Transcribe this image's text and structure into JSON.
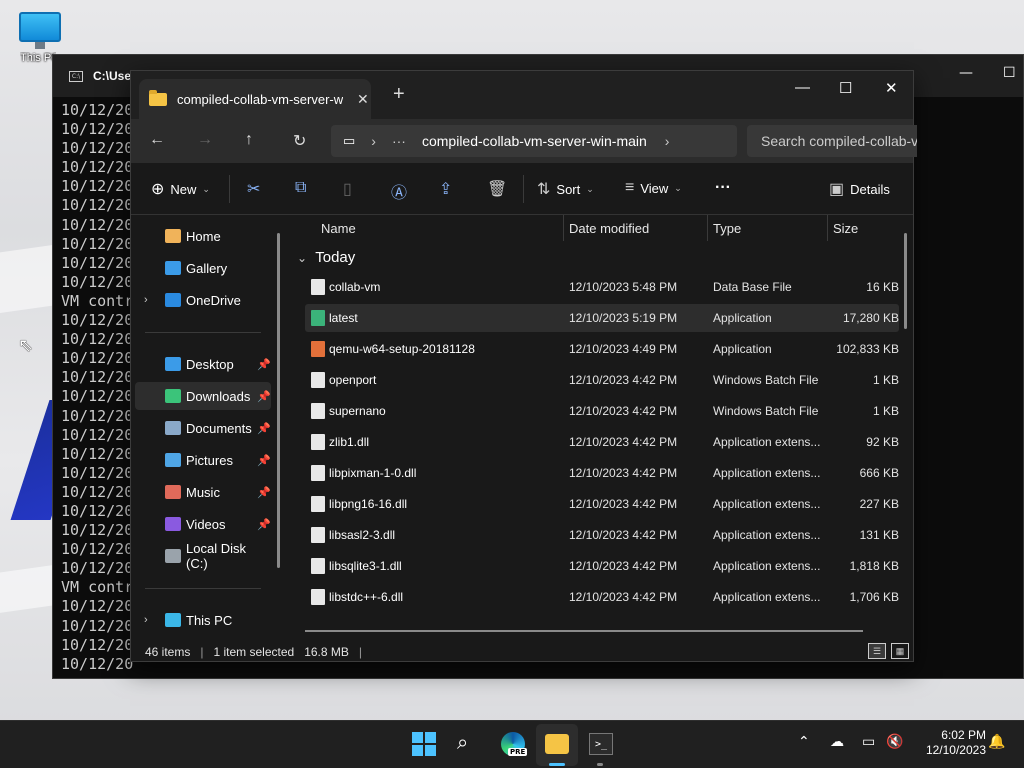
{
  "desktop": {
    "icon_label": "This PC",
    "cursor": "⇖"
  },
  "terminal": {
    "title": "C:\\Use",
    "tab_icon": "C:\\",
    "lines": [
      "10/12/20",
      "10/12/20",
      "10/12/20",
      "10/12/20",
      "10/12/20",
      "10/12/20",
      "10/12/20",
      "10/12/20",
      "10/12/20",
      "10/12/20",
      "VM contr",
      "10/12/20",
      "10/12/20",
      "10/12/20",
      "10/12/20",
      "10/12/20",
      "10/12/20",
      "10/12/20",
      "10/12/20",
      "10/12/20",
      "10/12/20",
      "10/12/20",
      "10/12/20",
      "10/12/20",
      "10/12/20",
      "VM contr",
      "10/12/20",
      "10/12/20",
      "10/12/20",
      "10/12/20"
    ]
  },
  "explorer": {
    "tab_title": "compiled-collab-vm-server-wi",
    "breadcrumb": "compiled-collab-vm-server-win-main",
    "search_placeholder": "Search compiled-collab-v",
    "toolbar": {
      "new": "New",
      "sort": "Sort",
      "view": "View",
      "details": "Details"
    },
    "sidebar": [
      {
        "label": "Home",
        "color": "#f0b35a"
      },
      {
        "label": "Gallery",
        "color": "#3b9be8"
      },
      {
        "label": "OneDrive",
        "color": "#2a8ae0"
      },
      {
        "label": "Desktop",
        "color": "#3b9be8"
      },
      {
        "label": "Downloads",
        "color": "#3bc47a"
      },
      {
        "label": "Documents",
        "color": "#8aa9c9"
      },
      {
        "label": "Pictures",
        "color": "#4fa6e6"
      },
      {
        "label": "Music",
        "color": "#e06a5a"
      },
      {
        "label": "Videos",
        "color": "#8a5ae0"
      },
      {
        "label": "Local Disk (C:)",
        "color": "#9aa3ab"
      },
      {
        "label": "This PC",
        "color": "#3bb7e8"
      }
    ],
    "columns": {
      "name": "Name",
      "date": "Date modified",
      "type": "Type",
      "size": "Size"
    },
    "group": "Today",
    "files": [
      {
        "name": "collab-vm",
        "date": "12/10/2023 5:48 PM",
        "type": "Data Base File",
        "size": "16 KB"
      },
      {
        "name": "latest",
        "date": "12/10/2023 5:19 PM",
        "type": "Application",
        "size": "17,280 KB"
      },
      {
        "name": "qemu-w64-setup-20181128",
        "date": "12/10/2023 4:49 PM",
        "type": "Application",
        "size": "102,833 KB"
      },
      {
        "name": "openport",
        "date": "12/10/2023 4:42 PM",
        "type": "Windows Batch File",
        "size": "1 KB"
      },
      {
        "name": "supernano",
        "date": "12/10/2023 4:42 PM",
        "type": "Windows Batch File",
        "size": "1 KB"
      },
      {
        "name": "zlib1.dll",
        "date": "12/10/2023 4:42 PM",
        "type": "Application extens...",
        "size": "92 KB"
      },
      {
        "name": "libpixman-1-0.dll",
        "date": "12/10/2023 4:42 PM",
        "type": "Application extens...",
        "size": "666 KB"
      },
      {
        "name": "libpng16-16.dll",
        "date": "12/10/2023 4:42 PM",
        "type": "Application extens...",
        "size": "227 KB"
      },
      {
        "name": "libsasl2-3.dll",
        "date": "12/10/2023 4:42 PM",
        "type": "Application extens...",
        "size": "131 KB"
      },
      {
        "name": "libsqlite3-1.dll",
        "date": "12/10/2023 4:42 PM",
        "type": "Application extens...",
        "size": "1,818 KB"
      },
      {
        "name": "libstdc++-6.dll",
        "date": "12/10/2023 4:42 PM",
        "type": "Application extens...",
        "size": "1,706 KB"
      }
    ],
    "status": {
      "count": "46 items",
      "selected": "1 item selected",
      "size": "16.8 MB"
    }
  },
  "taskbar": {
    "time": "6:02 PM",
    "date": "12/10/2023",
    "edge_badge": "PRE"
  }
}
